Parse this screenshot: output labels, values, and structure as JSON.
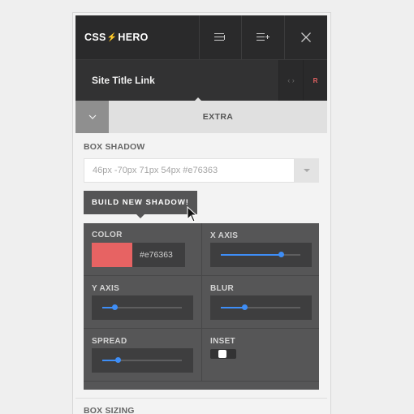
{
  "header": {
    "logo_left": "CSS",
    "logo_bolt": "⚡",
    "logo_right": "HERO"
  },
  "selection": {
    "title": "Site Title Link",
    "code_label": "‹ ›",
    "reset_label": "R"
  },
  "tab": {
    "name": "EXTRA"
  },
  "box_shadow": {
    "label": "BOX SHADOW",
    "value": "46px -70px 71px 54px  #e76363",
    "build_button": "BUILD NEW SHADOW!"
  },
  "controls": {
    "color": {
      "label": "COLOR",
      "hex": "#e76363",
      "swatch": "#e76363"
    },
    "x_axis": {
      "label": "X AXIS",
      "level": 0.75
    },
    "y_axis": {
      "label": "Y AXIS",
      "level": 0.15
    },
    "blur": {
      "label": "BLUR",
      "level": 0.3
    },
    "spread": {
      "label": "SPREAD",
      "level": 0.19
    },
    "inset": {
      "label": "INSET",
      "on": false
    }
  },
  "box_sizing": {
    "label": "BOX SIZING"
  },
  "colors": {
    "accent": "#3e8ef7",
    "brand": "#e76363",
    "dark": "#2a2a2b"
  }
}
